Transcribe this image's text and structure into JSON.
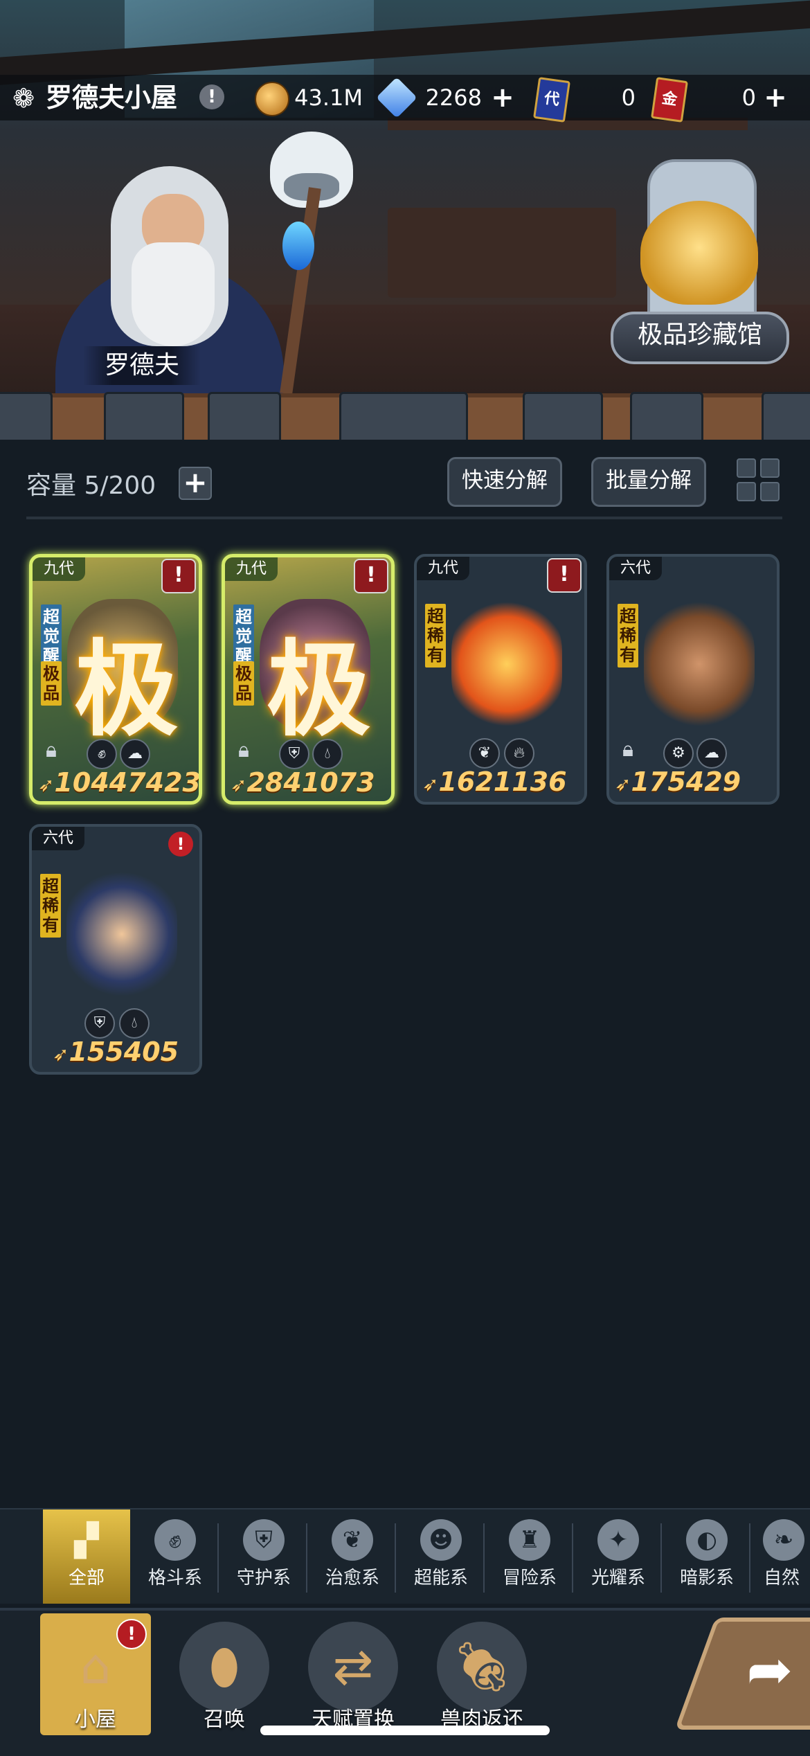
{
  "header": {
    "title": "罗德夫小屋",
    "info": "!",
    "coins": "43.1M",
    "crystals": "2268",
    "ticket_blue_label": "代",
    "ticket_blue": "0",
    "ticket_red_label": "金",
    "ticket_red": "0"
  },
  "scene": {
    "npc_name": "罗德夫",
    "museum_label": "极品珍藏馆"
  },
  "controls": {
    "capacity": "容量 5/200",
    "quick_decompose": "快速分解",
    "batch_decompose": "批量分解"
  },
  "cards": [
    {
      "gen": "九代",
      "rarity": "超觉醒",
      "sub": "极品",
      "big": "极",
      "power": "10447423",
      "locked": true,
      "tags": [
        "fist-icon",
        "cloud-icon"
      ]
    },
    {
      "gen": "九代",
      "rarity": "超觉醒",
      "sub": "极品",
      "big": "极",
      "power": "2841073",
      "locked": true,
      "tags": [
        "shield-icon",
        "water-drop-icon"
      ]
    },
    {
      "gen": "九代",
      "rarity": "超稀有",
      "power": "1621136",
      "locked": false,
      "tags": [
        "sprout-icon",
        "fire-icon"
      ]
    },
    {
      "gen": "六代",
      "rarity": "超稀有",
      "power": "175429",
      "locked": true,
      "tags": [
        "gear-icon",
        "cloud-icon"
      ]
    },
    {
      "gen": "六代",
      "rarity": "超稀有",
      "power": "155405",
      "locked": false,
      "tags": [
        "shield-icon",
        "water-drop-icon"
      ]
    }
  ],
  "categories": [
    {
      "label": "全部",
      "icon": "all-blocks-icon"
    },
    {
      "label": "格斗系",
      "icon": "fist-icon"
    },
    {
      "label": "守护系",
      "icon": "shield-icon"
    },
    {
      "label": "治愈系",
      "icon": "sprout-icon"
    },
    {
      "label": "超能系",
      "icon": "alien-icon"
    },
    {
      "label": "冒险系",
      "icon": "adventure-icon"
    },
    {
      "label": "光耀系",
      "icon": "light-icon"
    },
    {
      "label": "暗影系",
      "icon": "shadow-icon"
    },
    {
      "label": "自然",
      "icon": "nature-icon"
    }
  ],
  "nav": [
    {
      "label": "小屋",
      "alert": "!"
    },
    {
      "label": "召唤"
    },
    {
      "label": "天赋置换"
    },
    {
      "label": "兽肉返还"
    }
  ],
  "colors": {
    "background": "#141c24",
    "gold_accent": "#d9ae4a",
    "power_text": "#ffd070",
    "alert_red": "#8e1a1e"
  }
}
